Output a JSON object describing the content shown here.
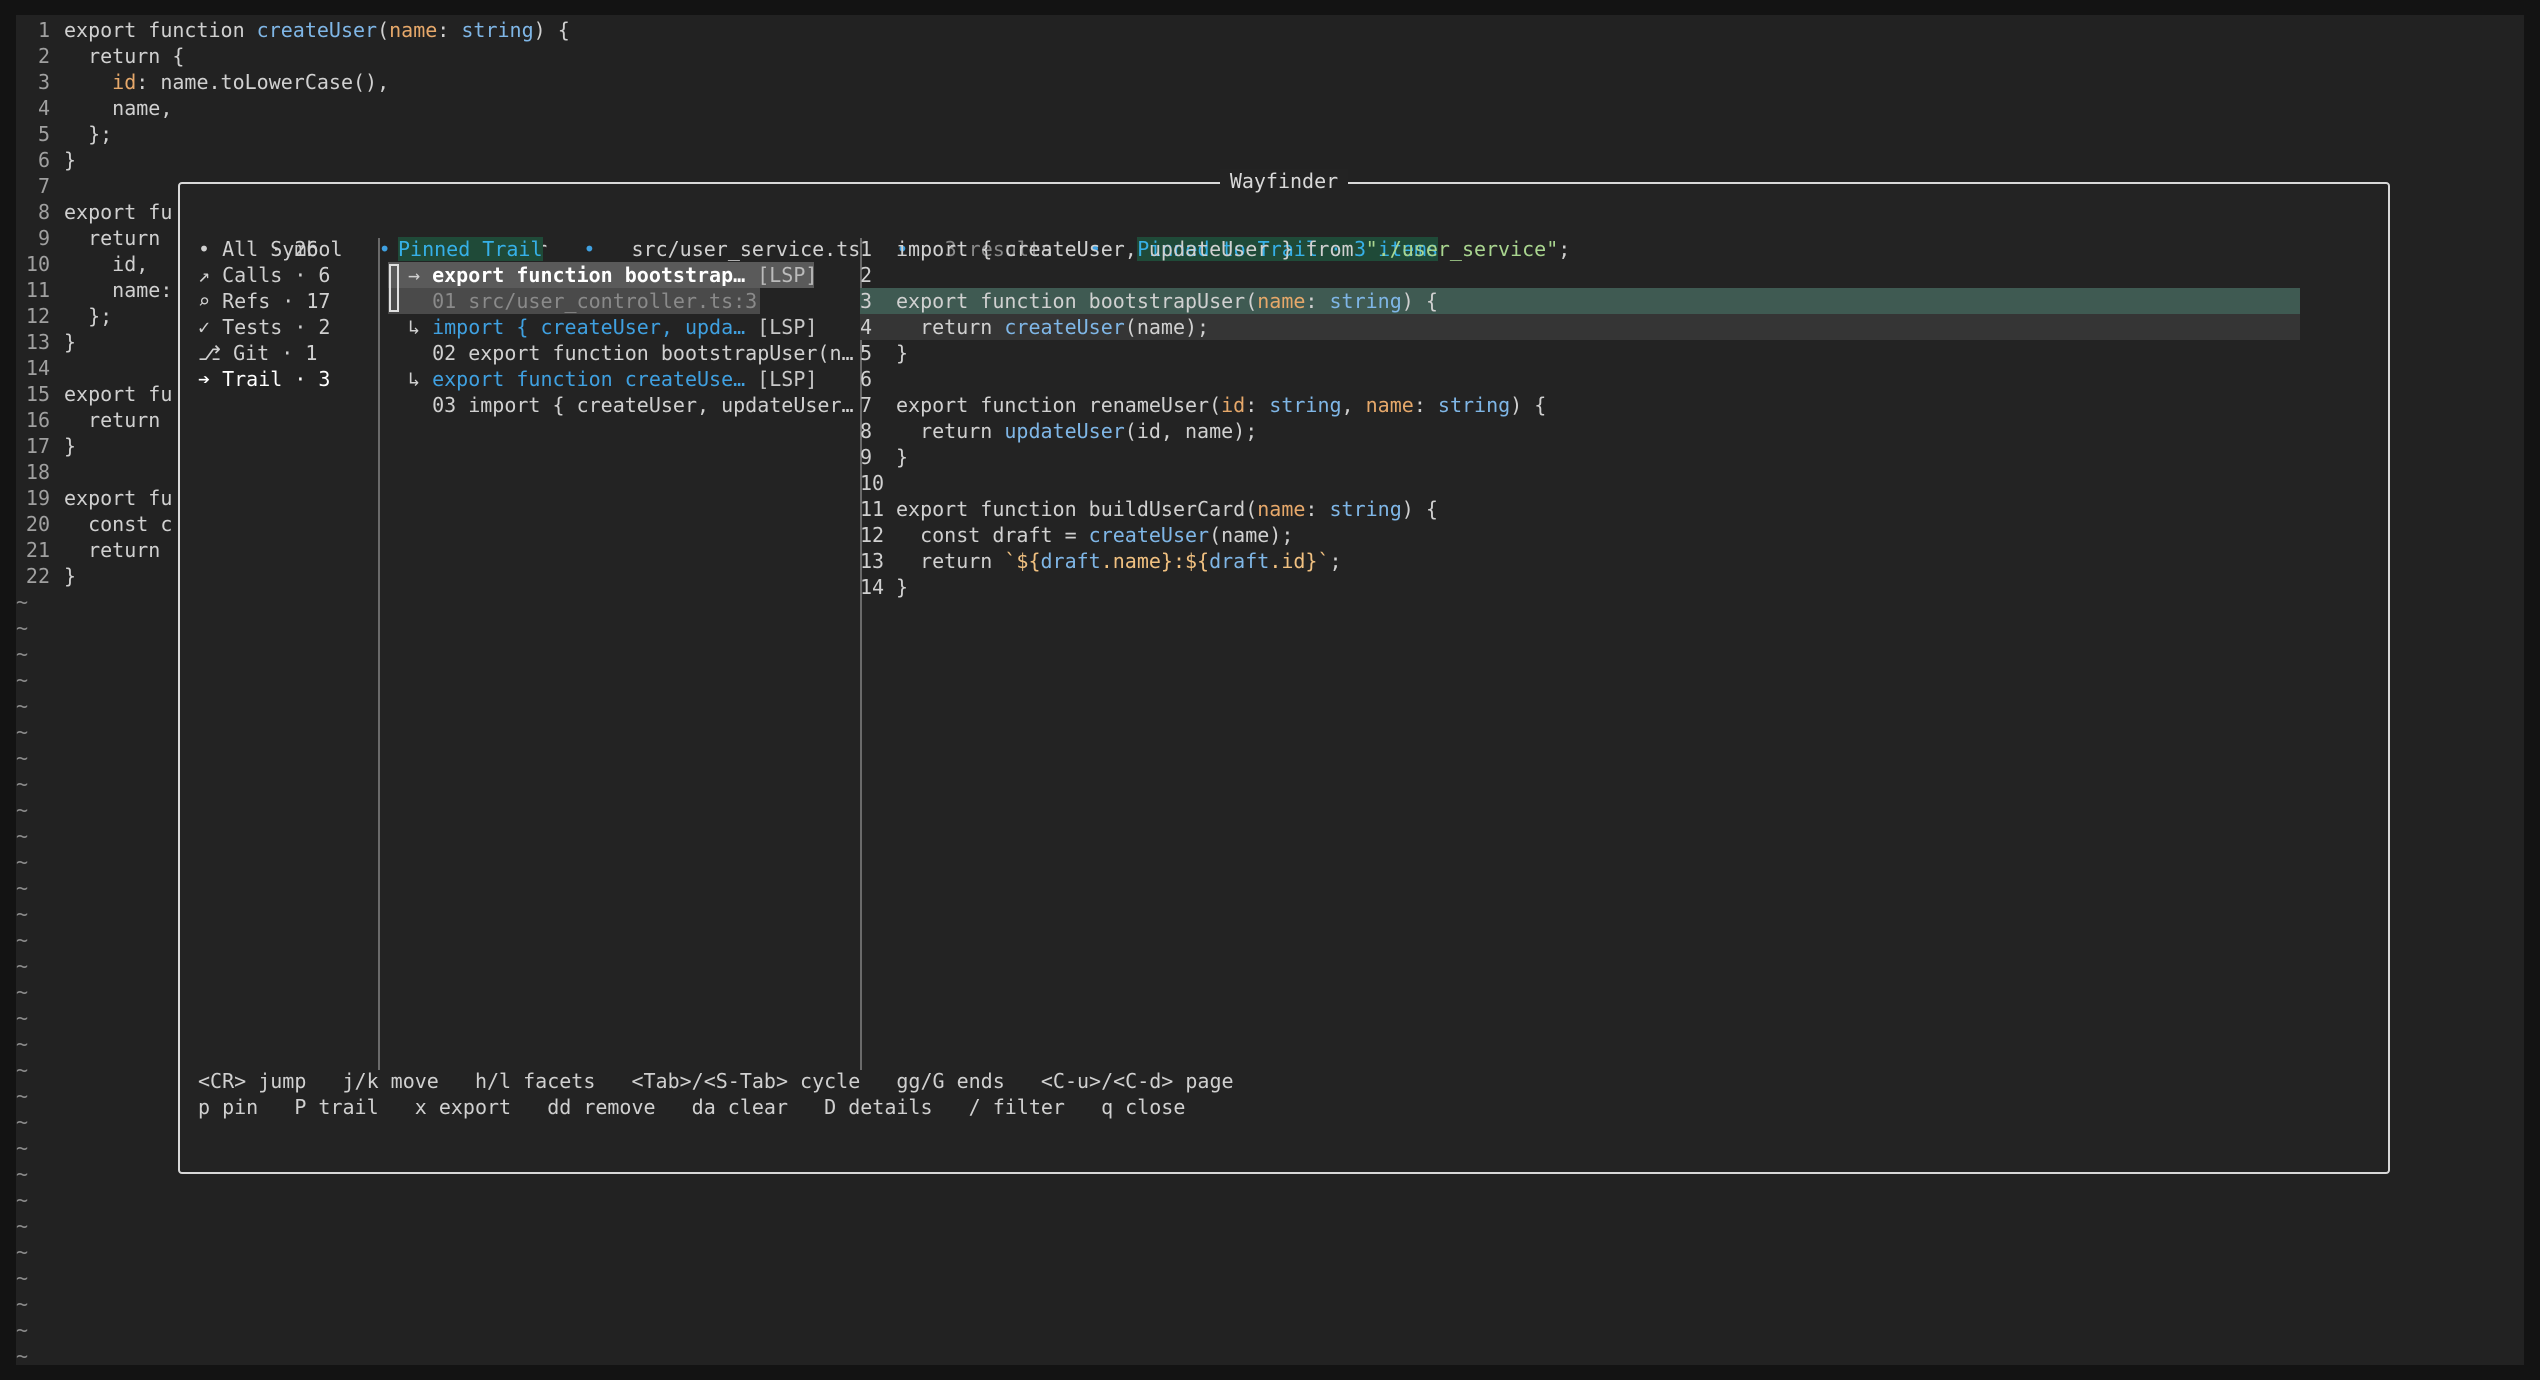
{
  "editor": {
    "lines": [
      {
        "n": "1",
        "code": "export function createUser(name: string) {"
      },
      {
        "n": "2",
        "code": "  return {"
      },
      {
        "n": "3",
        "code": "    id: name.toLowerCase(),"
      },
      {
        "n": "4",
        "code": "    name,"
      },
      {
        "n": "5",
        "code": "  };"
      },
      {
        "n": "6",
        "code": "}"
      },
      {
        "n": "7",
        "code": ""
      },
      {
        "n": "8",
        "code": "export fu"
      },
      {
        "n": "9",
        "code": "  return"
      },
      {
        "n": "10",
        "code": "    id,"
      },
      {
        "n": "11",
        "code": "    name:"
      },
      {
        "n": "12",
        "code": "  };"
      },
      {
        "n": "13",
        "code": "}"
      },
      {
        "n": "14",
        "code": ""
      },
      {
        "n": "15",
        "code": "export fu"
      },
      {
        "n": "16",
        "code": "  return"
      },
      {
        "n": "17",
        "code": "}"
      },
      {
        "n": "18",
        "code": ""
      },
      {
        "n": "19",
        "code": "export fu"
      },
      {
        "n": "20",
        "code": "  const c"
      },
      {
        "n": "21",
        "code": "  return"
      },
      {
        "n": "22",
        "code": "}"
      }
    ],
    "tilde": "~"
  },
  "wayfinder": {
    "title": "Wayfinder",
    "header": {
      "kind": "Symbol",
      "symbol": "createUser",
      "file": "src/user_service.ts",
      "results": "3 results",
      "pinned": "Pinned to Trail · 3 items",
      "sep": "•"
    },
    "facets": [
      {
        "icon": "•",
        "label": "All · 26"
      },
      {
        "icon": "↗",
        "label": "Calls · 6"
      },
      {
        "icon": "⌕",
        "label": "Refs · 17"
      },
      {
        "icon": "✓",
        "label": "Tests · 2"
      },
      {
        "icon": "⎇",
        "label": "Git · 1"
      },
      {
        "icon": "➔",
        "label": "Trail · 3"
      }
    ],
    "results": {
      "section": "Pinned Trail",
      "items": [
        {
          "prefix": "→ ",
          "text": "export function bootstrap…",
          "tag": "[LSP]"
        },
        {
          "prefix": "  ",
          "text": "01 src/user_controller.ts:3",
          "tag": ""
        },
        {
          "prefix": "↳ ",
          "text": "import { createUser, upda…",
          "tag": "[LSP]"
        },
        {
          "prefix": "  ",
          "text": "02 export function bootstrapUser(n…",
          "tag": ""
        },
        {
          "prefix": "↳ ",
          "text": "export function createUse…",
          "tag": "[LSP]"
        },
        {
          "prefix": "  ",
          "text": "03 import { createUser, updateUser…",
          "tag": ""
        }
      ]
    },
    "preview": [
      {
        "n": "1",
        "code": "import { createUser, updateUser } from \"./user_service\";"
      },
      {
        "n": "2",
        "code": ""
      },
      {
        "n": "3",
        "code": "export function bootstrapUser(name: string) {"
      },
      {
        "n": "4",
        "code": "  return createUser(name);"
      },
      {
        "n": "5",
        "code": "}"
      },
      {
        "n": "6",
        "code": ""
      },
      {
        "n": "7",
        "code": "export function renameUser(id: string, name: string) {"
      },
      {
        "n": "8",
        "code": "  return updateUser(id, name);"
      },
      {
        "n": "9",
        "code": "}"
      },
      {
        "n": "10",
        "code": ""
      },
      {
        "n": "11",
        "code": "export function buildUserCard(name: string) {"
      },
      {
        "n": "12",
        "code": "  const draft = createUser(name);"
      },
      {
        "n": "13",
        "code": "  return `${draft.name}:${draft.id}`;"
      },
      {
        "n": "14",
        "code": "}"
      }
    ],
    "help": {
      "line1": "<CR> jump   j/k move   h/l facets   <Tab>/<S-Tab> cycle   gg/G ends   <C-u>/<C-d> page",
      "line2": "p pin   P trail   x export   dd remove   da clear   D details   / filter   q close"
    }
  }
}
